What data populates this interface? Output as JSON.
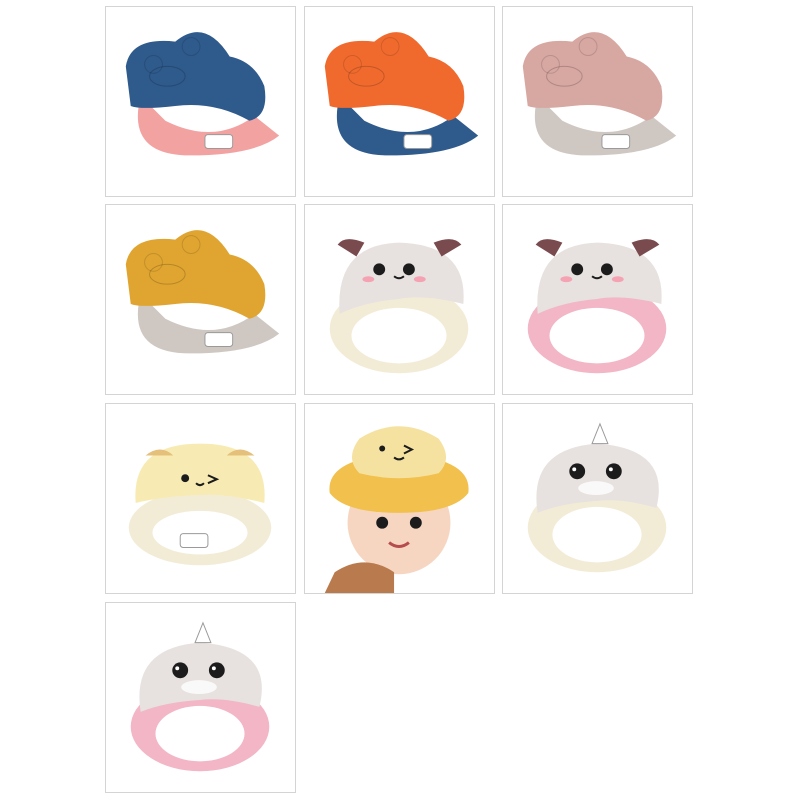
{
  "products": [
    {
      "name": "navy-pink-bear-visor",
      "top_color": "#2f5a8c",
      "brim_color": "#f3a2a2",
      "kind": "bear"
    },
    {
      "name": "orange-navy-bear-visor",
      "top_color": "#f06a2e",
      "brim_color": "#2f5a8c",
      "kind": "bear"
    },
    {
      "name": "dusty-pink-grey-bear-visor",
      "top_color": "#d7a7a2",
      "brim_color": "#cfc8c2",
      "kind": "bear"
    },
    {
      "name": "mustard-grey-bear-visor",
      "top_color": "#e0a530",
      "brim_color": "#cfc8c2",
      "kind": "bear"
    },
    {
      "name": "grey-cream-face-visor",
      "top_color": "#e7e2df",
      "brim_color": "#f2ecd7",
      "kind": "face"
    },
    {
      "name": "grey-pink-face-visor",
      "top_color": "#e7e2df",
      "brim_color": "#f2b6c6",
      "kind": "face"
    },
    {
      "name": "yellow-bear-face-visor",
      "top_color": "#f7ebb3",
      "brim_color": "#f2ecd7",
      "kind": "yellow-face"
    },
    {
      "name": "baby-wearing-yellow-visor",
      "top_color": "#f5e2a0",
      "brim_color": "#f1c04d",
      "kind": "photo"
    },
    {
      "name": "grey-cream-unicorn-visor",
      "top_color": "#e7e2df",
      "brim_color": "#f2ecd7",
      "kind": "unicorn"
    },
    {
      "name": "grey-pink-unicorn-visor",
      "top_color": "#e7e2df",
      "brim_color": "#f2b6c6",
      "kind": "unicorn"
    }
  ]
}
